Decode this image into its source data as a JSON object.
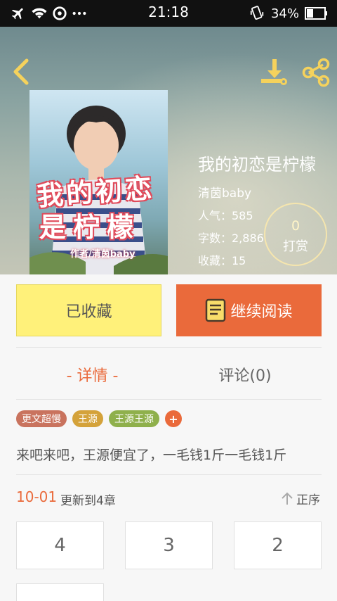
{
  "status_bar": {
    "time": "21:18",
    "battery": "34%",
    "icons": [
      "airplane-icon",
      "wifi-icon",
      "sync-icon",
      "more-dots-icon",
      "phone-vibrate-icon",
      "battery-icon"
    ]
  },
  "header": {
    "back_icon": "chevron-left-icon",
    "download_icon": "download-icon",
    "share_icon": "share-icon"
  },
  "book": {
    "cover": {
      "line1": "我的初恋",
      "line2": "是柠檬",
      "author_line": "作者/清茵baby"
    },
    "title": "我的初恋是柠檬",
    "author": "清茵baby",
    "popularity": "人气：585",
    "word_count": "字数：2,886",
    "favorites": "收藏：15"
  },
  "tip": {
    "count": "0",
    "label": "打赏"
  },
  "actions": {
    "favorited_label": "已收藏",
    "continue_label": "继续阅读",
    "continue_icon": "book-icon"
  },
  "tabs": {
    "detail": "- 详情 -",
    "comments": "评论(0)"
  },
  "tags": [
    {
      "label": "更文超慢",
      "color": "#c9735e"
    },
    {
      "label": "王源",
      "color": "#d4a23a"
    },
    {
      "label": "王源王源",
      "color": "#8fb04c"
    }
  ],
  "tag_add": "+",
  "description": "来吧来吧，王源便宜了，一毛钱1斤一毛钱1斤",
  "update": {
    "date": "10-01",
    "text": "更新到4章",
    "sort_label": "正序",
    "sort_icon": "arrow-up-icon"
  },
  "chapters": [
    "4",
    "3",
    "2"
  ],
  "colors": {
    "accent": "#ea6a3b",
    "favorited_bg": "#fff17a"
  }
}
